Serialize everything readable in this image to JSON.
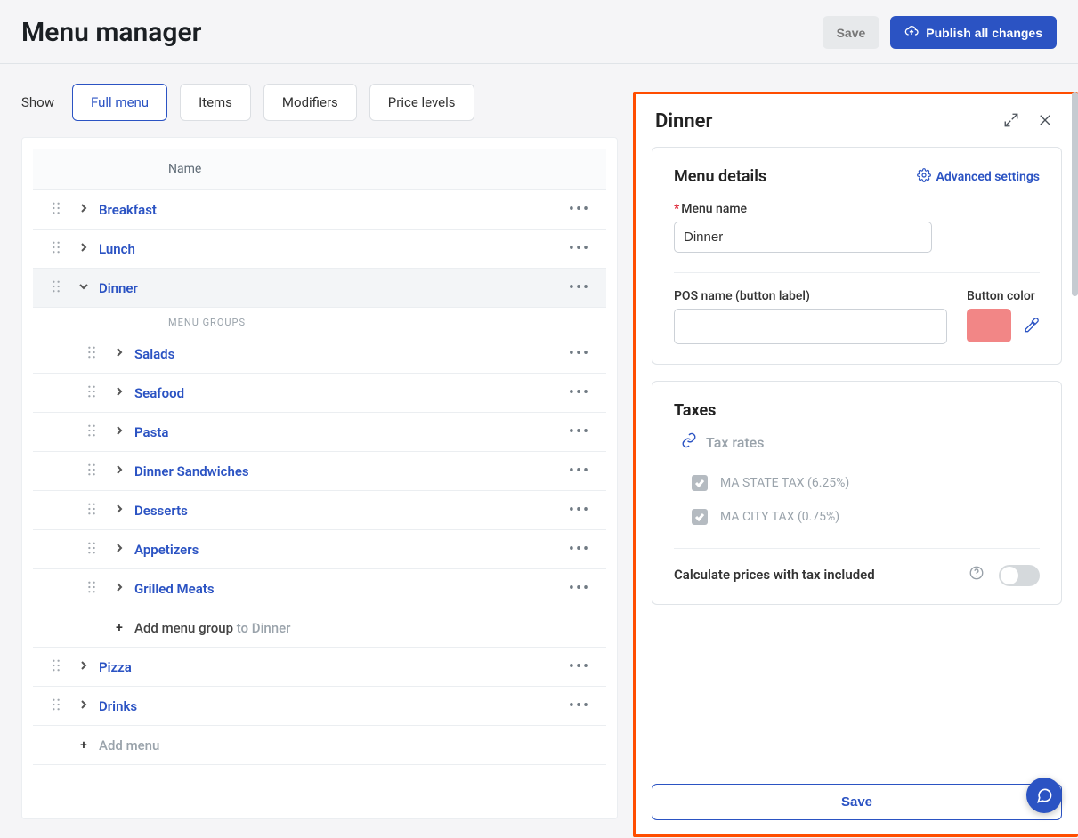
{
  "header": {
    "title": "Menu manager",
    "save_label": "Save",
    "publish_label": "Publish all changes"
  },
  "toolbar": {
    "show_label": "Show",
    "tabs": [
      {
        "label": "Full menu",
        "active": true
      },
      {
        "label": "Items",
        "active": false
      },
      {
        "label": "Modifiers",
        "active": false
      },
      {
        "label": "Price levels",
        "active": false
      }
    ]
  },
  "list": {
    "column_header": "Name",
    "groups_label": "MENU GROUPS",
    "menus": [
      {
        "name": "Breakfast",
        "expanded": false,
        "selected": false
      },
      {
        "name": "Lunch",
        "expanded": false,
        "selected": false
      },
      {
        "name": "Dinner",
        "expanded": true,
        "selected": true,
        "groups": [
          {
            "name": "Salads"
          },
          {
            "name": "Seafood"
          },
          {
            "name": "Pasta"
          },
          {
            "name": "Dinner Sandwiches"
          },
          {
            "name": "Desserts"
          },
          {
            "name": "Appetizers"
          },
          {
            "name": "Grilled Meats"
          }
        ],
        "add_group_label": "Add menu group",
        "add_group_suffix": "to Dinner"
      },
      {
        "name": "Pizza",
        "expanded": false,
        "selected": false
      },
      {
        "name": "Drinks",
        "expanded": false,
        "selected": false
      }
    ],
    "add_menu_label": "Add menu"
  },
  "side": {
    "title": "Dinner",
    "details": {
      "heading": "Menu details",
      "advanced_label": "Advanced settings",
      "menu_name_label": "Menu name",
      "menu_name_value": "Dinner",
      "pos_name_label": "POS name (button label)",
      "pos_name_value": "",
      "button_color_label": "Button color",
      "button_color": "#f28686"
    },
    "taxes": {
      "heading": "Taxes",
      "tax_rates_label": "Tax rates",
      "items": [
        {
          "label": "MA STATE TAX (6.25%)",
          "checked": true
        },
        {
          "label": "MA CITY TAX (0.75%)",
          "checked": true
        }
      ],
      "tax_included_label": "Calculate prices with tax included",
      "tax_included": false
    },
    "footer": {
      "save_label": "Save"
    }
  }
}
